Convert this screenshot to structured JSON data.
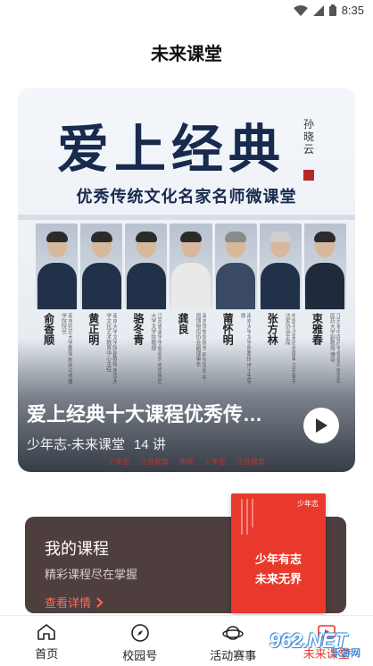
{
  "status_bar": {
    "time": "8:35"
  },
  "header": {
    "title": "未来课堂"
  },
  "hero": {
    "calligraphy_title": "爱上经典",
    "signature": "孙晓云",
    "subtitle": "优秀传统文化名家名师微课堂",
    "teachers": [
      {
        "name": "俞香顺",
        "desc": "南京师范大学教授 新闻与传播学院院长"
      },
      {
        "name": "黄正明",
        "desc": "南京大学文学院副教授 南京大学文化艺术教育中心主任"
      },
      {
        "name": "骆冬青",
        "desc": "江苏省美学学会会长 南京师范大学文学院教授"
      },
      {
        "name": "龚良",
        "desc": "南京博物院院长 研究馆员 中国博物馆协会副理事长"
      },
      {
        "name": "莆怀明",
        "desc": "南京大学文学院教授 博士生导师"
      },
      {
        "name": "张方林",
        "desc": "中国书法家协会理事 江苏省书法家协会主席"
      },
      {
        "name": "束雅春",
        "desc": "江苏省中医药学会会员 南京中医药大学副教授 博导"
      }
    ],
    "course_title": "爱上经典十大课程优秀传…",
    "author": "少年志-未来课堂",
    "lessons": "14 讲",
    "partner_logos": [
      "少年志",
      "江苏教育",
      "新闻",
      "少年志",
      "江苏教育"
    ]
  },
  "my_course": {
    "title": "我的课程",
    "subtitle": "精彩课程尽在掌握",
    "link_label": "查看详情",
    "book": {
      "top_label": "少年志",
      "text_line1": "少年有志",
      "text_line2": "未来无界"
    }
  },
  "tabs": [
    {
      "label": "首页",
      "icon": "home-icon"
    },
    {
      "label": "校园号",
      "icon": "compass-icon"
    },
    {
      "label": "活动赛事",
      "icon": "planet-icon"
    },
    {
      "label": "未来课堂",
      "icon": "classroom-icon",
      "active": true
    }
  ],
  "watermark": {
    "logo": "962.NET",
    "sub": "乐游网"
  },
  "colors": {
    "accent": "#e8392c",
    "card_bg": "#4e3e3e",
    "link": "#ff6a55"
  }
}
